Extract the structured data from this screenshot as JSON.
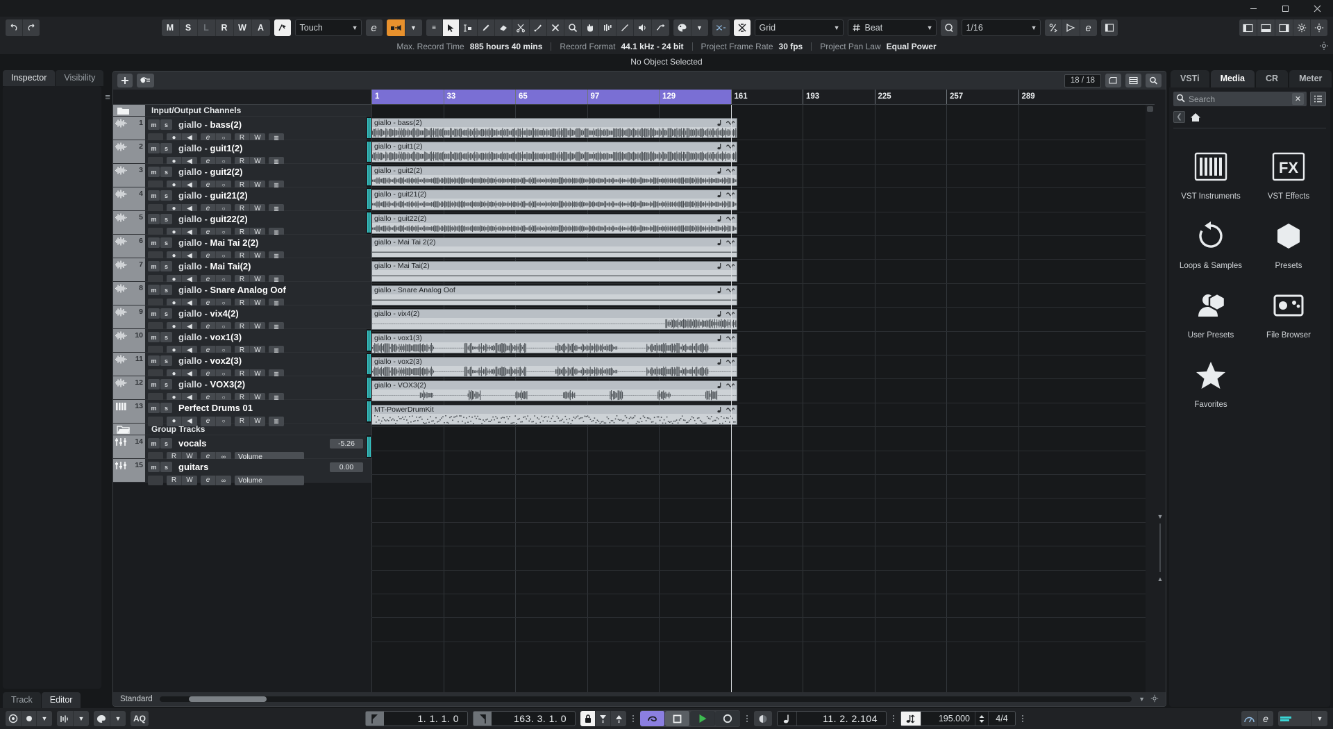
{
  "window": {
    "minimize": "–",
    "maximize": "❐",
    "close": "✕"
  },
  "toolbar": {
    "undo_label": "↶",
    "redo_label": "↷",
    "automation_modes": [
      "M",
      "S",
      "L",
      "R",
      "W",
      "A"
    ],
    "automation_mode_value": "Touch",
    "constrain_label": "e",
    "snap_mode_value": "Grid",
    "grid_type_value": "Beat",
    "quantize_value": "1/16"
  },
  "info_line": {
    "items": [
      {
        "key": "Max. Record Time",
        "value": "885 hours 40 mins"
      },
      {
        "key": "Record Format",
        "value": "44.1 kHz - 24 bit"
      },
      {
        "key": "Project Frame Rate",
        "value": "30 fps"
      },
      {
        "key": "Project Pan Law",
        "value": "Equal Power"
      }
    ]
  },
  "object_line": {
    "text": "No Object Selected"
  },
  "left_panel": {
    "tabs": [
      {
        "label": "Inspector",
        "active": false
      },
      {
        "label": "Visibility",
        "active": false
      }
    ],
    "bottom_tabs": [
      {
        "label": "Track",
        "active": false
      },
      {
        "label": "Editor",
        "active": true
      }
    ]
  },
  "project": {
    "add_track_label": "+",
    "track_count": "18 / 18",
    "preset_label": "Standard",
    "folders": [
      {
        "label": "Input/Output Channels"
      },
      {
        "label": "Group Tracks"
      }
    ],
    "tracks": [
      {
        "num": "1",
        "name_prefix": "giallo - ",
        "name": "bass(2)",
        "type": "audio",
        "event": "giallo - bass(2)",
        "wave": "full",
        "meter": true
      },
      {
        "num": "2",
        "name_prefix": "giallo - ",
        "name": "guit1(2)",
        "type": "audio",
        "event": "giallo - guit1(2)",
        "wave": "full",
        "meter": true
      },
      {
        "num": "3",
        "name_prefix": "giallo - ",
        "name": "guit2(2)",
        "type": "audio",
        "event": "giallo - guit2(2)",
        "wave": "mid",
        "meter": true
      },
      {
        "num": "4",
        "name_prefix": "giallo - ",
        "name": "guit21(2)",
        "type": "audio",
        "event": "giallo - guit21(2)",
        "wave": "mid",
        "meter": true
      },
      {
        "num": "5",
        "name_prefix": "giallo - ",
        "name": "guit22(2)",
        "type": "audio",
        "event": "giallo - guit22(2)",
        "wave": "mid",
        "meter": true
      },
      {
        "num": "6",
        "name_prefix": "giallo - ",
        "name": "Mai Tai 2(2)",
        "type": "audio",
        "event": "giallo - Mai Tai 2(2)",
        "wave": "flat",
        "meter": false
      },
      {
        "num": "7",
        "name_prefix": "giallo - ",
        "name": "Mai Tai(2)",
        "type": "audio",
        "event": "giallo - Mai Tai(2)",
        "wave": "flat",
        "meter": false
      },
      {
        "num": "8",
        "name_prefix": "giallo - ",
        "name": "Snare Analog Oof",
        "type": "audio",
        "event": "giallo - Snare Analog Oof",
        "wave": "flat",
        "meter": false
      },
      {
        "num": "9",
        "name_prefix": "giallo - ",
        "name": "vix4(2)",
        "type": "audio",
        "event": "giallo - vix4(2)",
        "wave": "tail",
        "meter": false
      },
      {
        "num": "10",
        "name_prefix": "giallo - ",
        "name": "vox1(3)",
        "type": "audio",
        "event": "giallo - vox1(3)",
        "wave": "vox",
        "meter": true
      },
      {
        "num": "11",
        "name_prefix": "giallo - ",
        "name": "vox2(3)",
        "type": "audio",
        "event": "giallo - vox2(3)",
        "wave": "vox",
        "meter": true
      },
      {
        "num": "12",
        "name_prefix": "giallo - ",
        "name": "VOX3(2)",
        "type": "audio",
        "event": "giallo - VOX3(2)",
        "wave": "sparse",
        "meter": true
      },
      {
        "num": "13",
        "name_prefix": "",
        "name": "Perfect Drums 01",
        "type": "midi",
        "event": "MT-PowerDrumKit",
        "wave": "midi",
        "meter": true
      }
    ],
    "group_tracks": [
      {
        "num": "14",
        "name": "vocals",
        "volume": "-5.26",
        "param": "Volume",
        "meter": true
      },
      {
        "num": "15",
        "name": "guitars",
        "volume": "0.00",
        "param": "Volume",
        "meter": false
      }
    ],
    "track_buttons": {
      "mute": "m",
      "solo": "s",
      "read": "R",
      "write": "W",
      "edit": "e"
    },
    "ruler": {
      "bars": [
        "1",
        "33",
        "65",
        "97",
        "129",
        "161",
        "193",
        "225",
        "257",
        "289"
      ],
      "selection_start": "1",
      "selection_end": "161"
    }
  },
  "right_panel": {
    "tabs": [
      {
        "label": "VSTi",
        "active": false
      },
      {
        "label": "Media",
        "active": true
      },
      {
        "label": "CR",
        "active": false
      },
      {
        "label": "Meter",
        "active": false
      }
    ],
    "search_placeholder": "Search",
    "search_value": "",
    "media_items": [
      {
        "label": "VST Instruments",
        "icon": "vst-instruments-icon"
      },
      {
        "label": "VST Effects",
        "icon": "fx-icon"
      },
      {
        "label": "Loops & Samples",
        "icon": "loops-samples-icon"
      },
      {
        "label": "Presets",
        "icon": "presets-icon"
      },
      {
        "label": "User Presets",
        "icon": "user-presets-icon"
      },
      {
        "label": "File Browser",
        "icon": "file-browser-icon"
      },
      {
        "label": "Favorites",
        "icon": "favorites-icon"
      }
    ]
  },
  "transport": {
    "left_locator": "1. 1. 1.  0",
    "right_locator": "163. 3. 1.  0",
    "primary_time": "11. 2. 2.104",
    "tempo": "195.000",
    "time_signature": "4/4",
    "aq_label": "AQ",
    "cycle_icon": "cycle-icon",
    "stop_icon": "stop-icon",
    "play_icon": "play-icon",
    "record_icon": "record-icon"
  },
  "colors": {
    "accent_orange": "#e8912d",
    "selection_purple": "#7a6fd4",
    "play_green": "#3dbb50",
    "meter_cyan": "#3ad6d6"
  }
}
